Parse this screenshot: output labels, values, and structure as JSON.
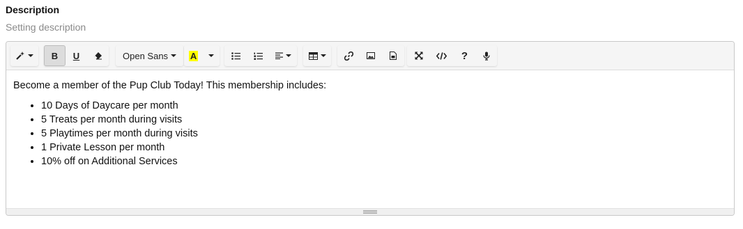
{
  "field": {
    "label": "Description",
    "hint": "Setting description"
  },
  "toolbar": {
    "style_icon": "magic-wand-icon",
    "bold_label": "B",
    "underline_label": "U",
    "eraser_icon": "eraser-icon",
    "font_name": "Open Sans",
    "color_label": "A",
    "highlight_color": "#ffff00",
    "buttons": [
      "style",
      "bold",
      "underline",
      "clear-format",
      "font-family",
      "color",
      "color-dropdown",
      "unordered-list",
      "ordered-list",
      "paragraph-align",
      "table",
      "link",
      "picture",
      "file",
      "fullscreen",
      "code-view",
      "help",
      "voice"
    ]
  },
  "content": {
    "intro": "Become a member of the Pup Club Today! This membership includes:",
    "items": [
      "10 Days of Daycare per month",
      "5 Treats per month during visits",
      "5 Playtimes per month during visits",
      "1 Private Lesson per month",
      "10% off on Additional Services"
    ]
  }
}
